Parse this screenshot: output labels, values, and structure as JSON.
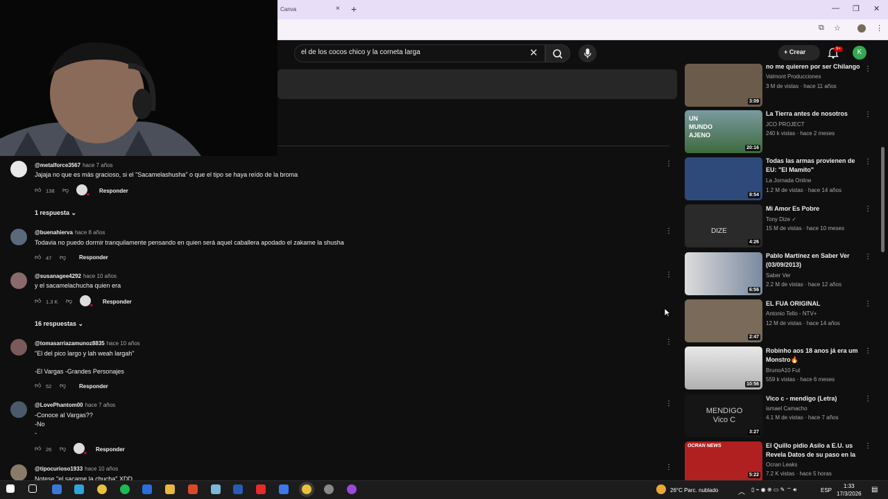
{
  "browser": {
    "tab_title": "Canva",
    "tab_close": "×",
    "new_tab": "+",
    "window_minimize": "—",
    "window_restore": "❐",
    "window_close": "✕"
  },
  "header": {
    "search_query": "el de los cocos chico y la corneta larga",
    "search_clear": "✕",
    "create_label": "Crear",
    "notifications_badge": "9+",
    "avatar_letter": "K"
  },
  "comments": [
    {
      "handle": "@metalforce3567",
      "time": "hace 7 años",
      "text": "Jajaja no que es más gracioso, si el \"Sacamelashusha\" o que el tipo se haya reído de la broma",
      "likes": "138",
      "reply_label": "Responder",
      "creator_heart": true,
      "replies_label": "1 respuesta"
    },
    {
      "handle": "@buenahierva",
      "time": "hace 8 años",
      "text": "Todavia no puedo dormir tranquilamente pensando en quien será aquel caballera apodado el zakame la shusha",
      "likes": "47",
      "reply_label": "Responder",
      "creator_heart": false
    },
    {
      "handle": "@susanagee4292",
      "time": "hace 10 años",
      "text": "y el sacamelachucha quien era",
      "likes": "1.3 K",
      "reply_label": "Responder",
      "creator_heart": true,
      "replies_label": "16 respuestas"
    },
    {
      "handle": "@tomasarriazamunoz8835",
      "time": "hace 10 años",
      "text": "\"El del pico largo y lah weah largah\"\n\n-El Vargas -Grandes Personajes",
      "likes": "52",
      "reply_label": "Responder",
      "creator_heart": false
    },
    {
      "handle": "@LovePhantom00",
      "time": "hace 7 años",
      "text": "-Conoce al Vargas??\n-No\n-...",
      "likes": "26",
      "reply_label": "Responder",
      "creator_heart": true
    },
    {
      "handle": "@tipocurioso1933",
      "time": "hace 10 años",
      "text": "Notese \"el sacame la chucha\" XDD",
      "likes": "",
      "reply_label": "",
      "creator_heart": false
    }
  ],
  "sidebar": [
    {
      "title": "no me quieren por ser Chilango",
      "channel": "Valmont Producciones",
      "meta": "3 M de vistas · hace 11 años",
      "duration": "3:09",
      "thumb_color": "#6b5b4a"
    },
    {
      "title": "La Tierra antes de nosotros",
      "channel": "JCO PROJECT",
      "meta": "240 k vistas · hace 2 meses",
      "duration": "20:16",
      "thumb_color": "#5a7a5a",
      "thumb_text": "UN MUNDO AJENO"
    },
    {
      "title": "Todas las armas provienen de EU: \"El Mamito\"",
      "channel": "La Jornada Online",
      "meta": "1.2 M de vistas · hace 14 años",
      "duration": "8:54",
      "thumb_color": "#2e4a7a"
    },
    {
      "title": "Mi Amor Es Pobre",
      "channel": "Tony Dize",
      "meta": "15 M de vistas · hace 10 meses",
      "duration": "4:26",
      "thumb_color": "#3a3a3a",
      "thumb_text": "DIZE",
      "verified": true
    },
    {
      "title": "Pablo Martínez en Saber Ver (03/09/2013)",
      "channel": "Saber Ver",
      "meta": "2.2 M de vistas · hace 12 años",
      "duration": "6:56",
      "thumb_color": "#8a8a8a"
    },
    {
      "title": "EL FUA ORIGINAL",
      "channel": "Antonio Tello - NTV+",
      "meta": "12 M de vistas · hace 14 años",
      "duration": "2:47",
      "thumb_color": "#7a6a5a"
    },
    {
      "title": "Robinho aos 18 anos já era um Monstro🔥",
      "channel": "BrunoA10 Fut",
      "meta": "559 k vistas · hace 6 meses",
      "duration": "10:56",
      "thumb_color": "#d0d0d0"
    },
    {
      "title": "Vico c - mendigo (Letra)",
      "channel": "ismael Camacho",
      "meta": "4.1 M de vistas · hace 7 años",
      "duration": "3:27",
      "thumb_color": "#151515",
      "thumb_text": "MENDIGO Vico C"
    },
    {
      "title": "El Quillo pidio Asilo a E.U. us Revela Datos de su paso en la ...",
      "channel": "Ocran Leaks",
      "meta": "7.2 K vistas · hace 5 horas",
      "duration": "5:22",
      "thumb_color": "#b02020",
      "thumb_text": "OCRAN NEWS"
    }
  ],
  "taskbar": {
    "weather": "26°C  Parc. nublado",
    "lang": "ESP",
    "time": "1:33",
    "date": "17/3/2026"
  }
}
